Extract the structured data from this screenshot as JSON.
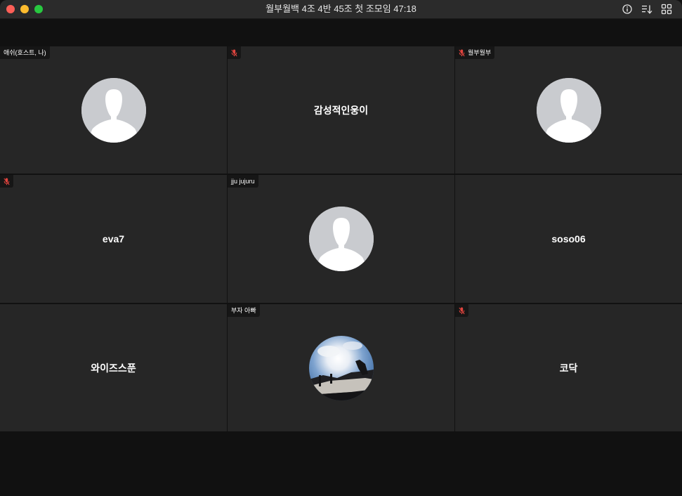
{
  "window": {
    "title": "월부월백 4조 4반 45조 첫 조모임 47:18"
  },
  "toolbar_icons": [
    "info-icon",
    "sort-icon",
    "gallery-grid-icon"
  ],
  "colors": {
    "tile_bg": "#262626",
    "muted_mic": "#e0443e",
    "avatar_placeholder": "#c9cbcf"
  },
  "participants": [
    {
      "label": "애쉬(호스트, 나)",
      "center_name": "",
      "muted": false,
      "display": "avatar"
    },
    {
      "label": "",
      "center_name": "감성적인웅이",
      "muted": true,
      "display": "name"
    },
    {
      "label": "월부월부",
      "center_name": "",
      "muted": true,
      "display": "avatar"
    },
    {
      "label": "",
      "center_name": "eva7",
      "muted": true,
      "display": "name"
    },
    {
      "label": "jju jujuru",
      "center_name": "",
      "muted": false,
      "display": "avatar"
    },
    {
      "label": "",
      "center_name": "soso06",
      "muted": false,
      "display": "name"
    },
    {
      "label": "",
      "center_name": "와이즈스푼",
      "muted": false,
      "display": "name"
    },
    {
      "label": "부자 아빠",
      "center_name": "",
      "muted": false,
      "display": "photo"
    },
    {
      "label": "",
      "center_name": "코닥",
      "muted": true,
      "display": "name"
    }
  ]
}
